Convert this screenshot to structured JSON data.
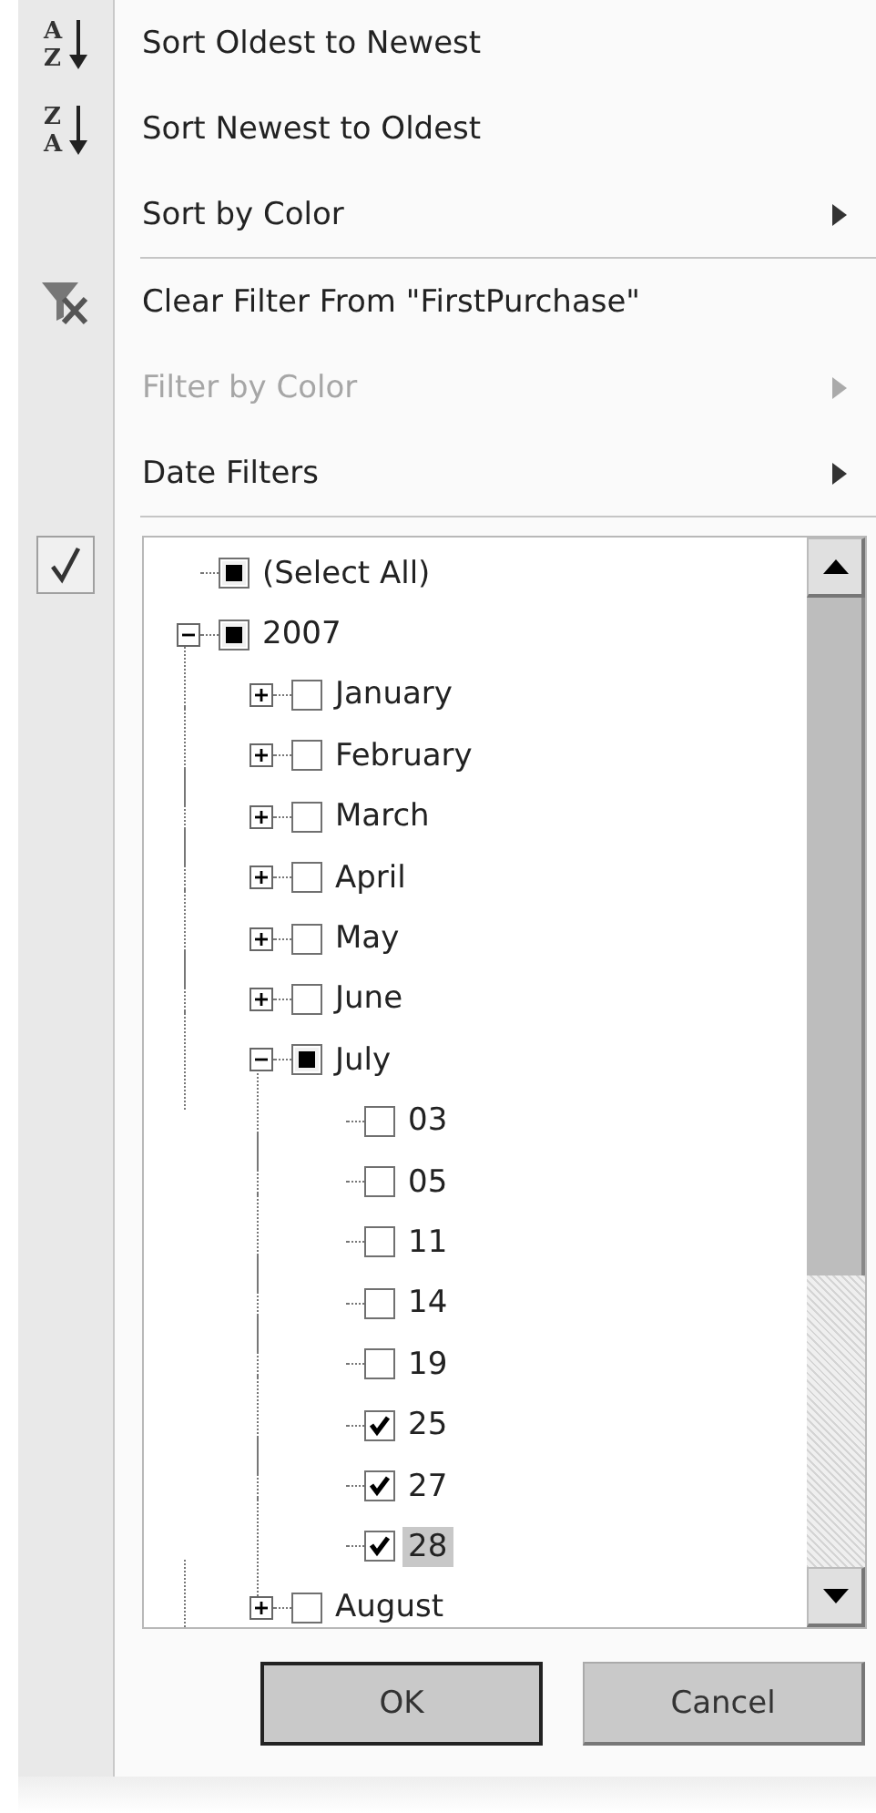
{
  "menu": {
    "items": [
      {
        "kind": "sort_asc",
        "label": "Sort Oldest to Newest",
        "icon_letters": [
          "A",
          "Z"
        ],
        "disabled": false,
        "submenu": false,
        "separator_after": false
      },
      {
        "kind": "sort_desc",
        "label": "Sort Newest to Oldest",
        "icon_letters": [
          "Z",
          "A"
        ],
        "disabled": false,
        "submenu": false,
        "separator_after": false
      },
      {
        "kind": "plain",
        "label": "Sort by Color",
        "disabled": false,
        "submenu": true,
        "separator_after": true
      },
      {
        "kind": "clear_filter",
        "label": "Clear Filter From \"FirstPurchase\"",
        "disabled": false,
        "submenu": false,
        "separator_after": false
      },
      {
        "kind": "plain",
        "label": "Filter by Color",
        "disabled": true,
        "submenu": true,
        "separator_after": false
      },
      {
        "kind": "plain",
        "label": "Date Filters",
        "disabled": false,
        "submenu": true,
        "separator_after": true
      }
    ]
  },
  "filter_list": {
    "active": true,
    "tree": [
      {
        "label": "(Select All)",
        "checked": false,
        "mixed": true,
        "selected": false
      },
      {
        "label": "2007",
        "checked": false,
        "mixed": true,
        "expanded": true,
        "selected": false,
        "children": [
          {
            "label": "January",
            "checked": false,
            "mixed": false,
            "expanded": false,
            "selected": false
          },
          {
            "label": "February",
            "checked": false,
            "mixed": false,
            "expanded": false,
            "selected": false
          },
          {
            "label": "March",
            "checked": false,
            "mixed": false,
            "expanded": false,
            "selected": false
          },
          {
            "label": "April",
            "checked": false,
            "mixed": false,
            "expanded": false,
            "selected": false
          },
          {
            "label": "May",
            "checked": false,
            "mixed": false,
            "expanded": false,
            "selected": false
          },
          {
            "label": "June",
            "checked": false,
            "mixed": false,
            "expanded": false,
            "selected": false
          },
          {
            "label": "July",
            "checked": false,
            "mixed": true,
            "expanded": true,
            "selected": false,
            "children": [
              {
                "label": "03",
                "checked": false,
                "mixed": false,
                "selected": false
              },
              {
                "label": "05",
                "checked": false,
                "mixed": false,
                "selected": false
              },
              {
                "label": "11",
                "checked": false,
                "mixed": false,
                "selected": false
              },
              {
                "label": "14",
                "checked": false,
                "mixed": false,
                "selected": false
              },
              {
                "label": "19",
                "checked": false,
                "mixed": false,
                "selected": false
              },
              {
                "label": "25",
                "checked": true,
                "mixed": false,
                "selected": false
              },
              {
                "label": "27",
                "checked": true,
                "mixed": false,
                "selected": false
              },
              {
                "label": "28",
                "checked": true,
                "mixed": false,
                "selected": true
              }
            ]
          },
          {
            "label": "August",
            "checked": false,
            "mixed": false,
            "expanded": false,
            "selected": false
          }
        ]
      }
    ]
  },
  "buttons": [
    {
      "label": "OK",
      "default": true
    },
    {
      "label": "Cancel",
      "default": false
    }
  ]
}
